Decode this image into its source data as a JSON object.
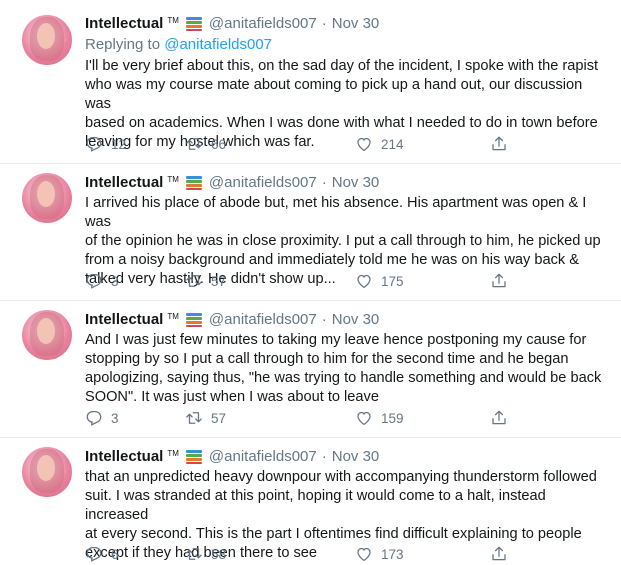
{
  "tweets": [
    {
      "name": "Intellectual",
      "tm": "TM",
      "handle": "@anitafields007",
      "separator": "·",
      "time": "Nov 30",
      "replying_prefix": "Replying to",
      "replying_handle": "@anitafields007",
      "text_lines": [
        "I'll be very brief about this, on the sad day of the incident, I spoke with the rapist",
        "who was my course mate about coming to pick up a hand out, our discussion was",
        "based on academics. When I was done with what I needed to do in town before",
        "leaving for my hostel which was far."
      ],
      "replies": "12",
      "retweets": "66",
      "likes": "214"
    },
    {
      "name": "Intellectual",
      "tm": "TM",
      "handle": "@anitafields007",
      "separator": "·",
      "time": "Nov 30",
      "text_lines": [
        "I arrived his place of abode but, met his absence. His apartment was open & I was",
        "of the opinion he was in close proximity. I put a call through to him, he picked up",
        "from a noisy background and immediately told me he was on his way back &",
        "talked very hastily. He didn't show up..."
      ],
      "replies": "3",
      "retweets": "57",
      "likes": "175"
    },
    {
      "name": "Intellectual",
      "tm": "TM",
      "handle": "@anitafields007",
      "separator": "·",
      "time": "Nov 30",
      "text_lines": [
        "And I was just few minutes to taking my leave hence postponing my cause for",
        "stopping by so I put a call through to him for the second time and he began",
        "apologizing, saying thus, \"he was trying to handle something and would be back",
        "SOON\". It was just when I was about to leave"
      ],
      "replies": "3",
      "retweets": "57",
      "likes": "159"
    },
    {
      "name": "Intellectual",
      "tm": "TM",
      "handle": "@anitafields007",
      "separator": "·",
      "time": "Nov 30",
      "text_lines": [
        "that an unpredicted heavy downpour with accompanying thunderstorm followed",
        "suit. I was stranded at this point, hoping it would come to a halt, instead increased",
        "at every second. This is the part I oftentimes find difficult explaining to people",
        "except if they had been there to see"
      ],
      "replies": "6",
      "retweets": "58",
      "likes": "173"
    }
  ],
  "icons": {
    "badge": "books-emoji-icon",
    "reply": "reply-icon",
    "retweet": "retweet-icon",
    "like": "heart-icon",
    "share": "share-icon"
  },
  "colors": {
    "link": "#1da1f2",
    "muted": "#657786",
    "text": "#14171a",
    "divider": "#e6ecf0"
  }
}
